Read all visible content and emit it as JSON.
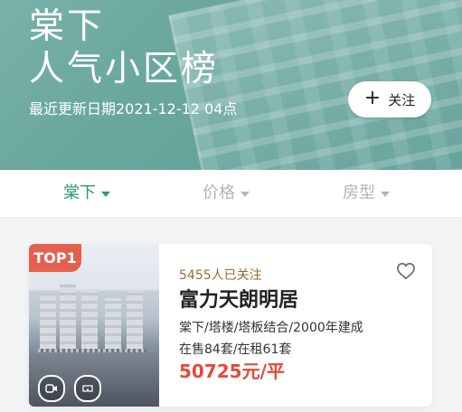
{
  "banner": {
    "title_line1": "棠下",
    "title_line2": "人气小区榜",
    "update_text": "最近更新日期2021-12-12 04点",
    "follow_label": "关注",
    "follow_icon": "plus-icon"
  },
  "filters": [
    {
      "label": "棠下",
      "active": true
    },
    {
      "label": "价格",
      "active": false
    },
    {
      "label": "房型",
      "active": false
    }
  ],
  "listing": {
    "badge": "TOP1",
    "followers": "5455人已关注",
    "name": "富力天朗明居",
    "meta": "棠下/塔楼/塔板结合/2000年建成",
    "counts": "在售84套/在租61套",
    "price": "50725元/平",
    "icons": [
      "video-icon",
      "vr-icon",
      "heart-icon"
    ]
  },
  "colors": {
    "banner": "#6aa79d",
    "active_tab": "#2f9a70",
    "badge": "#e4604e",
    "price": "#e24a3b",
    "followers": "#9b6a2f"
  }
}
